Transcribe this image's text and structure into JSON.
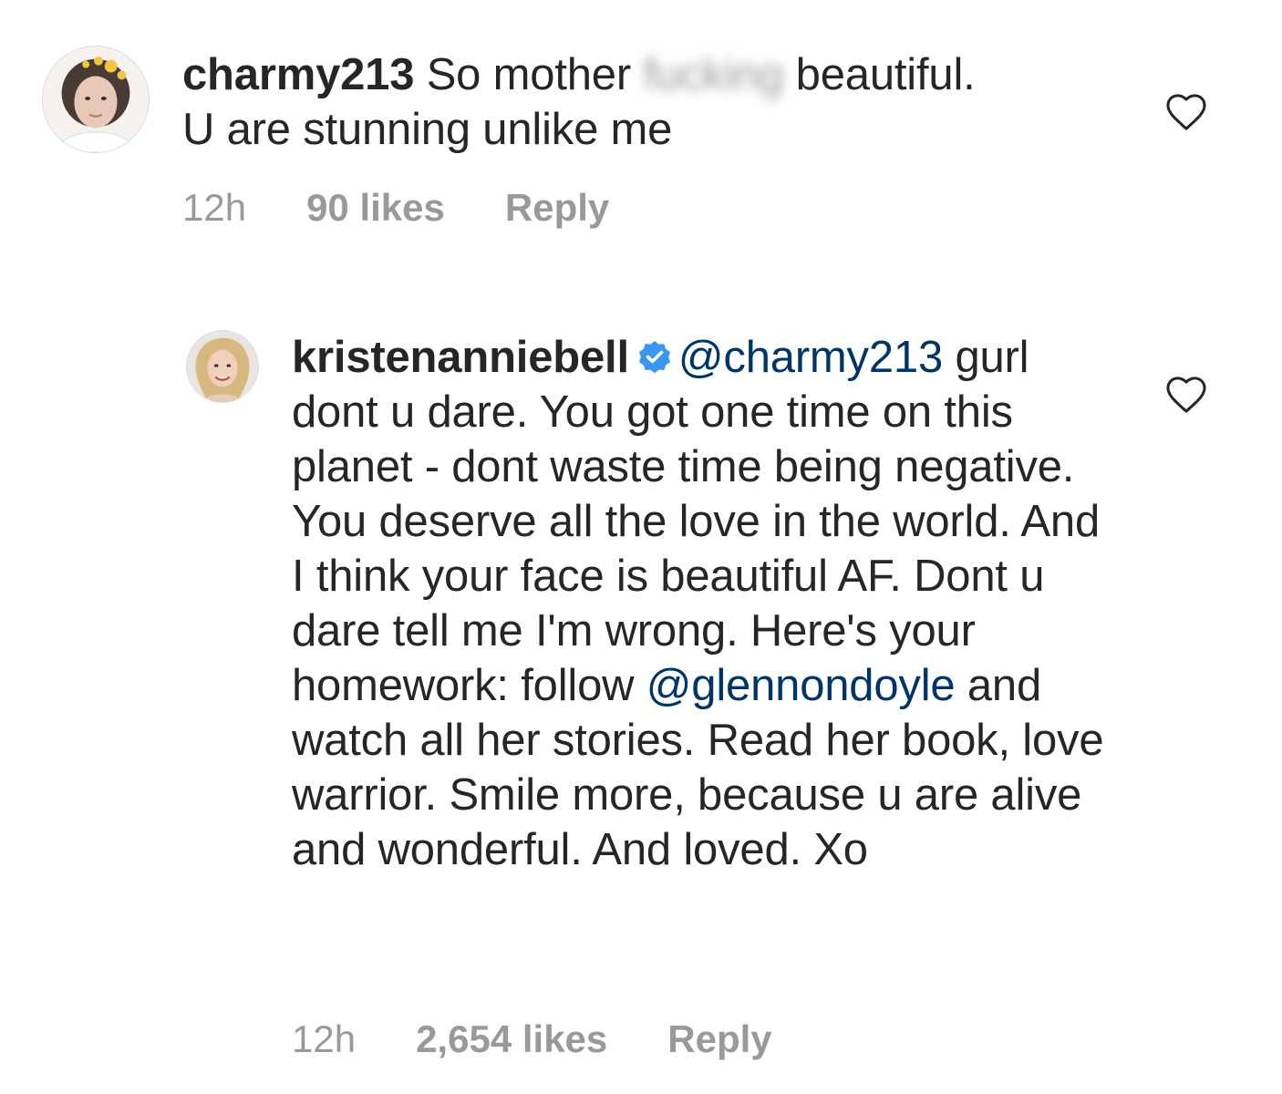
{
  "comments": [
    {
      "username": "charmy213",
      "text_before": "So mother",
      "censored_word": "fucking",
      "text_after": "beautiful.",
      "text_line2": "U are stunning unlike me",
      "time": "12h",
      "likes": "90 likes",
      "reply_label": "Reply",
      "like_icon": "heart-outline-icon"
    },
    {
      "username": "kristenanniebell",
      "verified_icon": "verified-badge-icon",
      "mention": "@charmy213",
      "text_a": "gurl dont u dare. You got one time on this planet - dont waste time being negative. You deserve all the love in the world. And I think your face is beautiful AF. Dont u dare tell me I'm wrong. Here's your homework: follow",
      "mention2": "@glennondoyle",
      "text_b": "and watch all her stories. Read her book, love warrior. Smile more, because u are alive and wonderful. And loved. Xo",
      "time": "12h",
      "likes": "2,654 likes",
      "reply_label": "Reply",
      "like_icon": "heart-outline-icon"
    }
  ],
  "colors": {
    "text": "#262626",
    "meta": "#999999",
    "mention": "#003569",
    "verified": "#3897f0"
  }
}
